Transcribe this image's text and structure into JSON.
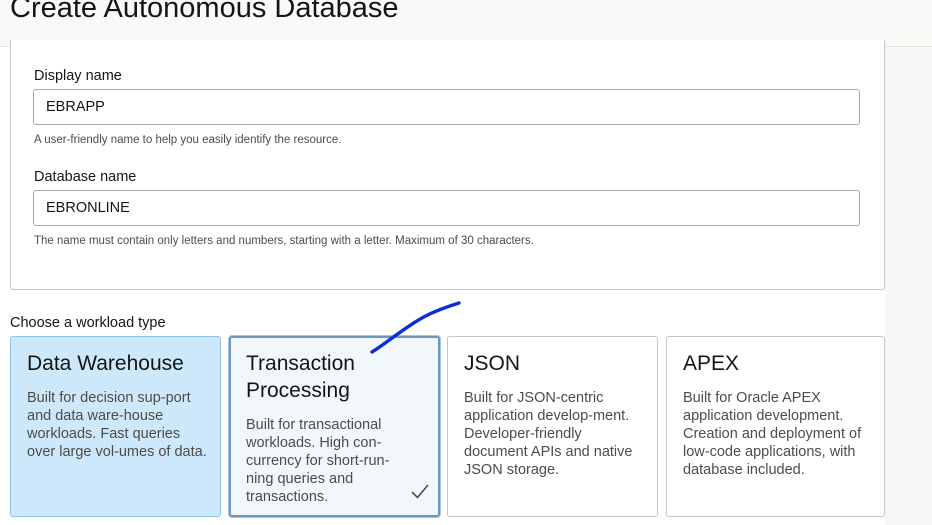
{
  "page": {
    "title": "Create Autonomous Database"
  },
  "form": {
    "display_name": {
      "label": "Display name",
      "value": "EBRAPP",
      "help": "A user-friendly name to help you easily identify the resource."
    },
    "database_name": {
      "label": "Database name",
      "value": "EBRONLINE",
      "help": "The name must contain only letters and numbers, starting with a letter. Maximum of 30 characters."
    }
  },
  "workload": {
    "heading": "Choose a workload type",
    "options": [
      {
        "title": "Data Warehouse",
        "description": "Built for decision sup-port and data ware-house workloads. Fast queries over large vol-umes of data.",
        "state": "selected"
      },
      {
        "title": "Transaction Processing",
        "description": "Built for transactional workloads. High con-currency for short-run-ning queries and transactions.",
        "state": "hovered",
        "icon": "check-icon"
      },
      {
        "title": "JSON",
        "description": "Built for JSON-centric application develop-ment. Developer-friendly document APIs and native JSON storage.",
        "state": "default"
      },
      {
        "title": "APEX",
        "description": "Built for Oracle APEX application development. Creation and deployment of low-code applications, with database included.",
        "state": "default"
      }
    ]
  },
  "colors": {
    "selected_card_bg": "#cde8fb",
    "hover_card_border": "#6c98bd",
    "annotation_ink": "#0b2fd6"
  }
}
